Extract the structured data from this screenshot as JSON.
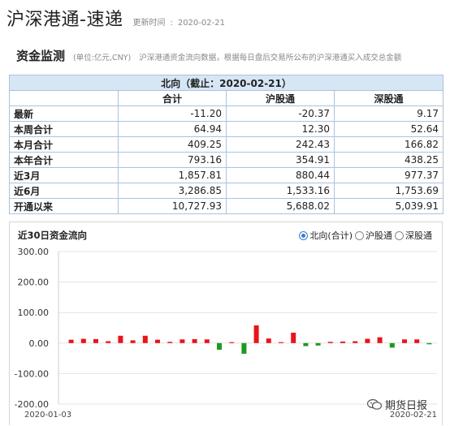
{
  "header": {
    "title": "沪深港通-速递",
    "update_label": "更新时间",
    "update_sep": ":",
    "update_date": "2020-02-21"
  },
  "section": {
    "title": "资金监测",
    "unit": "(单位:亿元,CNY)",
    "description": "沪深港通资金流向数据，根据每日盘后交易所公布的沪深港通买入成交总金额"
  },
  "table": {
    "caption": "北向（截止：2020-02-21）",
    "columns": [
      "",
      "合计",
      "沪股通",
      "深股通"
    ],
    "rows": [
      {
        "label": "最新",
        "total": "-11.20",
        "sh": "-20.37",
        "sz": "9.17"
      },
      {
        "label": "本周合计",
        "total": "64.94",
        "sh": "12.30",
        "sz": "52.64"
      },
      {
        "label": "本月合计",
        "total": "409.25",
        "sh": "242.43",
        "sz": "166.82"
      },
      {
        "label": "本年合计",
        "total": "793.16",
        "sh": "354.91",
        "sz": "438.25"
      },
      {
        "label": "近3月",
        "total": "1,857.81",
        "sh": "880.44",
        "sz": "977.37"
      },
      {
        "label": "近6月",
        "total": "3,286.85",
        "sh": "1,533.16",
        "sz": "1,753.69"
      },
      {
        "label": "开通以来",
        "total": "10,727.93",
        "sh": "5,688.02",
        "sz": "5,039.91"
      }
    ]
  },
  "chart_panel": {
    "title": "近30日资金流向",
    "options": [
      {
        "label": "北向(合计)",
        "checked": true
      },
      {
        "label": "沪股通",
        "checked": false
      },
      {
        "label": "深股通",
        "checked": false
      }
    ],
    "watermark": "期货日报"
  },
  "chart_data": {
    "type": "bar",
    "ylim": [
      -200,
      300
    ],
    "yticks": [
      "300.00",
      "200.00",
      "100.00",
      "0.00",
      "-100.00",
      "-200.00"
    ],
    "x_first_label": "2020-01-03",
    "x_last_label": "2020-02-21",
    "values": [
      11,
      14,
      13,
      6,
      24,
      9,
      24,
      11,
      4,
      12,
      13,
      12,
      -22,
      3,
      -35,
      58,
      15,
      3,
      34,
      -10,
      -8,
      4,
      5,
      6,
      14,
      19,
      -15,
      12,
      12,
      -4
    ],
    "colors": {
      "positive": "#e8141a",
      "negative": "#1e9a1e"
    },
    "grid": true
  }
}
